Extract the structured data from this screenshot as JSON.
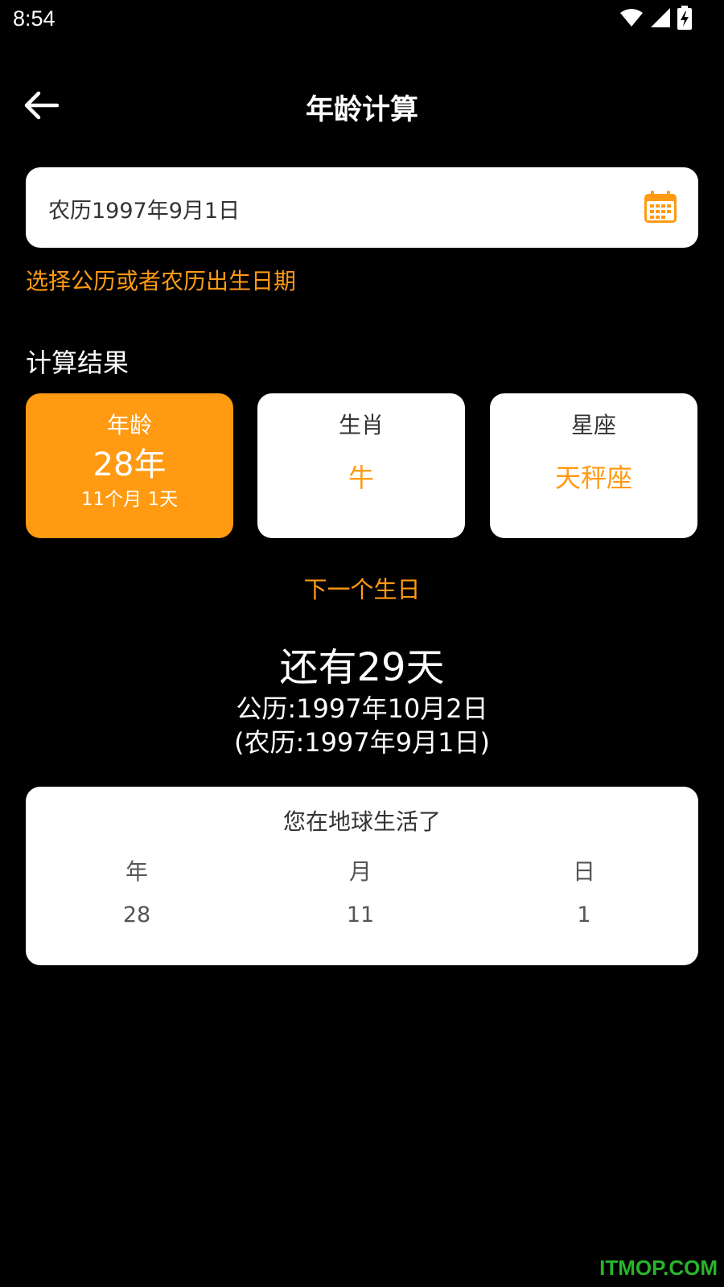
{
  "status_bar": {
    "time": "8:54",
    "icons": [
      "wifi-icon",
      "signal-icon",
      "battery-charging-icon"
    ]
  },
  "header": {
    "title": "年龄计算",
    "back_icon": "arrow-left-icon"
  },
  "date_input": {
    "value": "农历1997年9月1日",
    "icon": "calendar-icon"
  },
  "hint": "选择公历或者农历出生日期",
  "results": {
    "section_title": "计算结果",
    "age": {
      "label": "年龄",
      "years": "28年",
      "detail": "11个月 1天"
    },
    "zodiac": {
      "label": "生肖",
      "value": "牛"
    },
    "constellation": {
      "label": "星座",
      "value": "天秤座"
    }
  },
  "next_birthday": {
    "label": "下一个生日",
    "countdown": "还有29天",
    "solar": "公历:1997年10月2日",
    "lunar": "(农历:1997年9月1日)"
  },
  "earth_life": {
    "title": "您在地球生活了",
    "columns": [
      {
        "label": "年",
        "value": "28"
      },
      {
        "label": "月",
        "value": "11"
      },
      {
        "label": "日",
        "value": "1"
      }
    ]
  },
  "watermark": "ITMOP.COM",
  "colors": {
    "accent": "#ff9a12",
    "background": "#000000",
    "card": "#ffffff",
    "watermark": "#26b52a"
  }
}
